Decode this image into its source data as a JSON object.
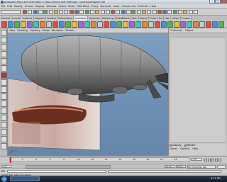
{
  "window": {
    "title": "Autodesk Maya 8.5 Unlimited: C:\\Documents and Settings\\...\\scenes\\zeppelin.mb"
  },
  "menubar": {
    "items": [
      "File",
      "Edit",
      "Modify",
      "Create",
      "Display",
      "Window",
      "Select",
      "Mesh",
      "Edit Mesh",
      "Proxy",
      "Normals",
      "Color",
      "Create UVs",
      "Edit UVs",
      "Help"
    ]
  },
  "shelf": {
    "tabs": [
      "General",
      "Curves",
      "Surfaces",
      "Polygons",
      "Subdivs",
      "Deformation",
      "Animation",
      "Dynamics",
      "Rendering",
      "PaintEffects",
      "Toon",
      "Muscle",
      "Fluids",
      "Fur",
      "Hair",
      "nCloth",
      "Custom"
    ],
    "active_tab": "Animation"
  },
  "panel_menu": {
    "items": [
      "View",
      "Shading",
      "Lighting",
      "Show",
      "Renderer",
      "Panels"
    ]
  },
  "channel_box": {
    "tabs": [
      "Channels",
      "Object"
    ],
    "layer_options": [
      "Display",
      "Render"
    ],
    "layer_menu": [
      "Layers",
      "Options",
      "Help"
    ]
  },
  "time_slider": {
    "ticks": [
      "2",
      "4",
      "6",
      "8",
      "10",
      "12",
      "14",
      "16",
      "18",
      "20",
      "22",
      "24"
    ],
    "current_frame": "1.00"
  },
  "range_slider": {
    "start": "1.00",
    "end": "24.00",
    "anim_end": "48.00",
    "char_set": "No Character Set"
  },
  "command_line": {
    "label": "MEL"
  },
  "help_line": {
    "text": "Select Tool: select an object"
  },
  "taskbar": {
    "time": "4:12 PM"
  },
  "colors": {
    "viewport_bg": "#6d8fb3",
    "zeppelin_body": "#8a8a8a"
  }
}
